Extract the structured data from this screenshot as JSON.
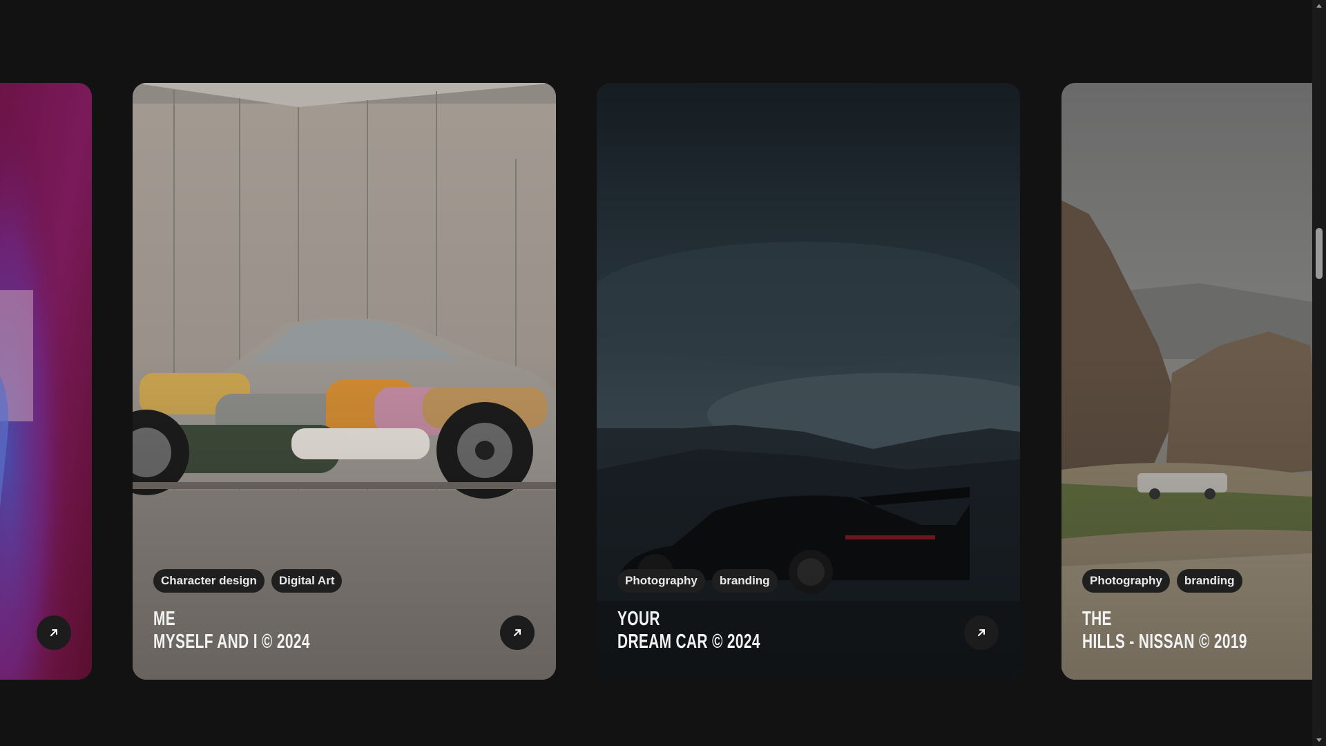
{
  "cards": [
    {
      "id": "card-left",
      "tags": [],
      "title_line1": "",
      "title_line2": ""
    },
    {
      "id": "card-me",
      "tags": [
        "Character design",
        "Digital Art"
      ],
      "title_line1": "ME",
      "title_line2": "MYSELF AND I © 2024"
    },
    {
      "id": "card-dreamcar",
      "tags": [
        "Photography",
        "branding"
      ],
      "title_line1": "YOUR",
      "title_line2": "DREAM CAR © 2024"
    },
    {
      "id": "card-hills",
      "tags": [
        "Photography",
        "branding"
      ],
      "title_line1": "THE",
      "title_line2": "HILLS - NISSAN © 2019"
    }
  ],
  "icons": {
    "open": "arrow-up-right-icon",
    "scroll_up": "chevron-up-icon",
    "scroll_down": "chevron-down-icon"
  },
  "colors": {
    "background": "#121212",
    "tag_bg": "#1f1f1f",
    "button_bg": "#1c1c1c"
  }
}
